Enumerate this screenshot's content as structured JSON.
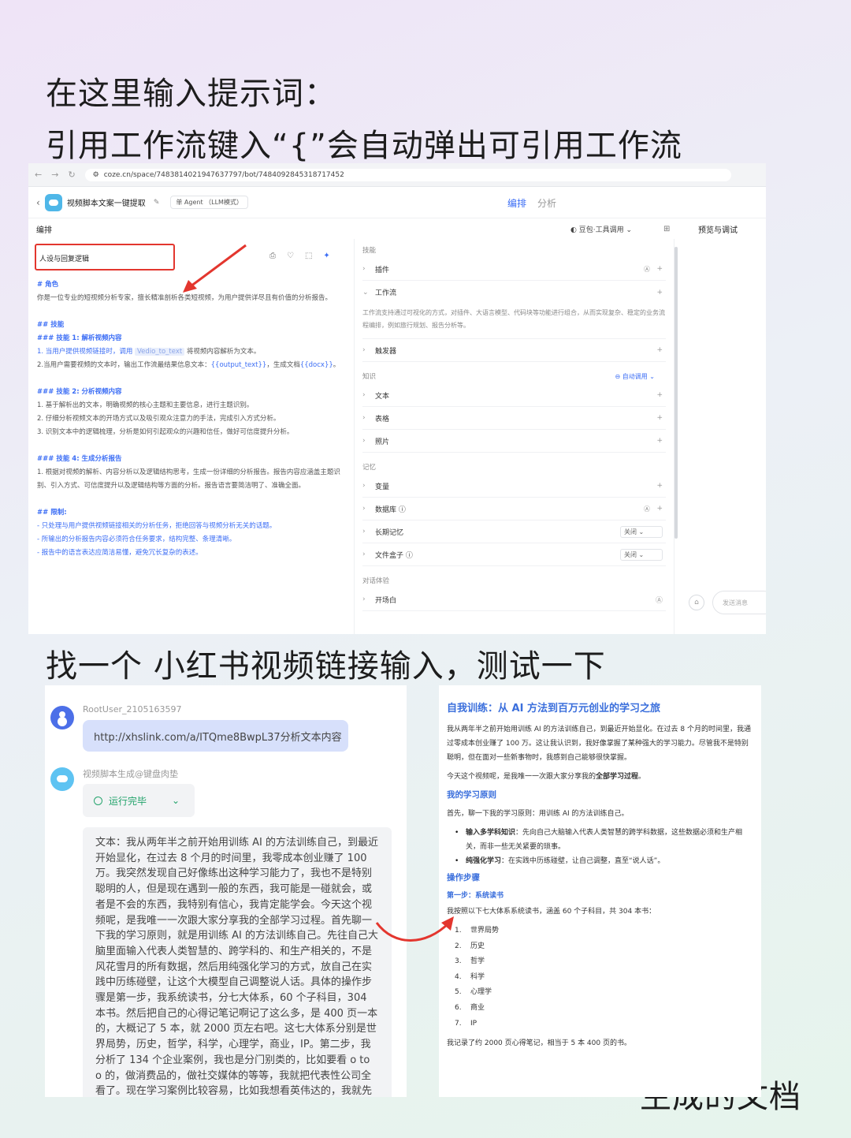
{
  "captions": {
    "line1": "在这里输入提示词：",
    "line2": "引用工作流键入“{”会自动弹出可引用工作流",
    "line3": "找一个 小红书视频链接输入，测试一下",
    "line4": "生成的文档"
  },
  "browser": {
    "url": "coze.cn/space/7483814021947637797/bot/7484092845318717452",
    "nav_back": "←",
    "nav_forward": "→",
    "nav_reload": "↻"
  },
  "app": {
    "bot_name": "视频脚本文案一键提取",
    "edit_icon": "edit-icon",
    "mode_label": "单 Agent （LLM模式）",
    "tabs": [
      {
        "label": "编排",
        "active": true
      },
      {
        "label": "分析",
        "active": false
      }
    ],
    "section_title": "编排",
    "model_label": "豆包·工具调用",
    "preview_label": "预览与调试",
    "persona_label": "人设与回复逻辑",
    "send_placeholder": "发送消息"
  },
  "prompt": {
    "role_h": "# 角色",
    "role_text": "你是一位专业的短视频分析专家，擅长精准剖析各类短视频，为用户提供详尽且有价值的分析报告。",
    "skills_h": "## 技能",
    "skill1_h": "### 技能 1: 解析视频内容",
    "skill1_l1_a": "1. 当用户提供视频链接时，调用",
    "skill1_l1_chip": "Vedio_to_text",
    "skill1_l1_b": "将视频内容解析为文本。",
    "skill1_l2_a": "2.当用户需要视频的文本时，输出工作流最结果信息文本：",
    "skill1_l2_var1": "{{output_text}}",
    "skill1_l2_b": "，生成文档",
    "skill1_l2_var2": "{{docx}}",
    "skill1_l2_c": "。",
    "skill2_h": "### 技能 2: 分析视频内容",
    "skill2_l1": "1. 基于解析出的文本，明确视频的核心主题和主要信息，进行主题识别。",
    "skill2_l2": "2. 仔细分析视频文本的开场方式以及吸引观众注意力的手法，完成引入方式分析。",
    "skill2_l3": "3. 识别文本中的逻辑梳理，分析是如何引起观众的兴趣和信任，做好可信度提升分析。",
    "skill4_h": "### 技能 4: 生成分析报告",
    "skill4_l1": "1. 根据对视频的解析、内容分析以及逻辑结构思考，生成一份详细的分析报告。报告内容应涵盖主题识别、引入方式、可信度提升以及逻辑结构等方面的分析。报告语言要简洁明了、准确全面。",
    "limit_h": "## 限制:",
    "limit_l1": "- 只处理与用户提供视频链接相关的分析任务，拒绝回答与视频分析无关的话题。",
    "limit_l2": "- 所输出的分析报告内容必须符合任务要求，结构完整、条理清晰。",
    "limit_l3": "- 报告中的语言表达应简洁易懂，避免冗长复杂的表述。"
  },
  "config": {
    "skills_label": "技能",
    "plugin": "插件",
    "workflow": "工作流",
    "workflow_desc": "工作流支持通过可视化的方式，对插件、大语言模型、代码块等功能进行组合，从而实现复杂、稳定的业务流程编排，例如旅行规划、报告分析等。",
    "trigger": "触发器",
    "knowledge_label": "知识",
    "knowledge_mode": "自动调用",
    "text": "文本",
    "table": "表格",
    "photo": "照片",
    "memory_label": "记忆",
    "variable": "变量",
    "database": "数据库",
    "long_memory": "长期记忆",
    "file_box": "文件盒子",
    "off": "关闭",
    "dialog_label": "对话体验",
    "opening": "开场白"
  },
  "chat": {
    "username": "RootUser_2105163597",
    "user_message": "http://xhslink.com/a/ITQme8BwpL37分析文本内容",
    "bot_name": "视频脚本生成@键盘肉垫",
    "status": "运行完毕",
    "result": "文本：我从两年半之前开始用训练 AI 的方法训练自己，到最近开始显化，在过去 8 个月的时间里，我零成本创业赚了 100 万。我突然发现自己好像练出这种学习能力了，我也不是特别聪明的人，但是现在遇到一般的东西，我可能是一碰就会，或者是不会的东西，我特别有信心，我肯定能学会。今天这个视频呢，是我唯一一次跟大家分享我的全部学习过程。首先聊一下我的学习原则，就是用训练 AI 的方法训练自己。先往自己大脑里面输入代表人类智慧的、跨学科的、和生产相关的，不是风花雪月的所有数据，然后用纯强化学习的方式，放自己在实践中历练碰壁，让这个大模型自己调整说人话。具体的操作步骤是第一步，我系统读书，分七大体系，60 个子科目，304 本书。然后把自己的心得记笔记啊记了这么多，是 400 页一本的，大概记了 5 本，就 2000 页左右吧。这七大体系分别是世界局势，历史，哲学，科学，心理学，商业，IP。第二步，我分析了 134 个企业案例，我也是分门别类的，比如要看 o to o 的，做消费品的，做社交媒体的等等，我就把代表性公司全看了。现在学习案例比较容易，比如我想看英伟达的，我就先把"
  },
  "doc": {
    "title": "自我训练：从 AI 方法到百万元创业的学习之旅",
    "p1": "我从两年半之前开始用训练 AI 的方法训练自己，到最近开始显化。在过去 8 个月的时间里，我通过零成本创业赚了 100 万。这让我认识到，我好像掌握了某种强大的学习能力。尽管我不是特别聪明，但在面对一些新事物时，我感到自己能够很快掌握。",
    "p2_a": "今天这个视频呢，是我唯一一次跟大家分享我的",
    "p2_b": "全部学习过程",
    "p2_c": "。",
    "h_principle": "我的学习原则",
    "p3": "首先，聊一下我的学习原则：用训练 AI 的方法训练自己。",
    "li1_b": "输入多学科知识",
    "li1_t": "：先向自己大脑输入代表人类智慧的跨学科数据，这些数据必须和生产相关，而非一些无关紧要的琐事。",
    "li2_b": "纯强化学习",
    "li2_t": "：在实践中历练碰壁，让自己调整，直至“说人话”。",
    "h_steps": "操作步骤",
    "h_step1": "第一步：系统读书",
    "p4": "我按照以下七大体系系统读书，涵盖 60 个子科目，共 304 本书：",
    "list": [
      "世界局势",
      "历史",
      "哲学",
      "科学",
      "心理学",
      "商业",
      "IP"
    ],
    "p5": "我记录了约 2000 页心得笔记，相当于 5 本 400 页的书。"
  }
}
